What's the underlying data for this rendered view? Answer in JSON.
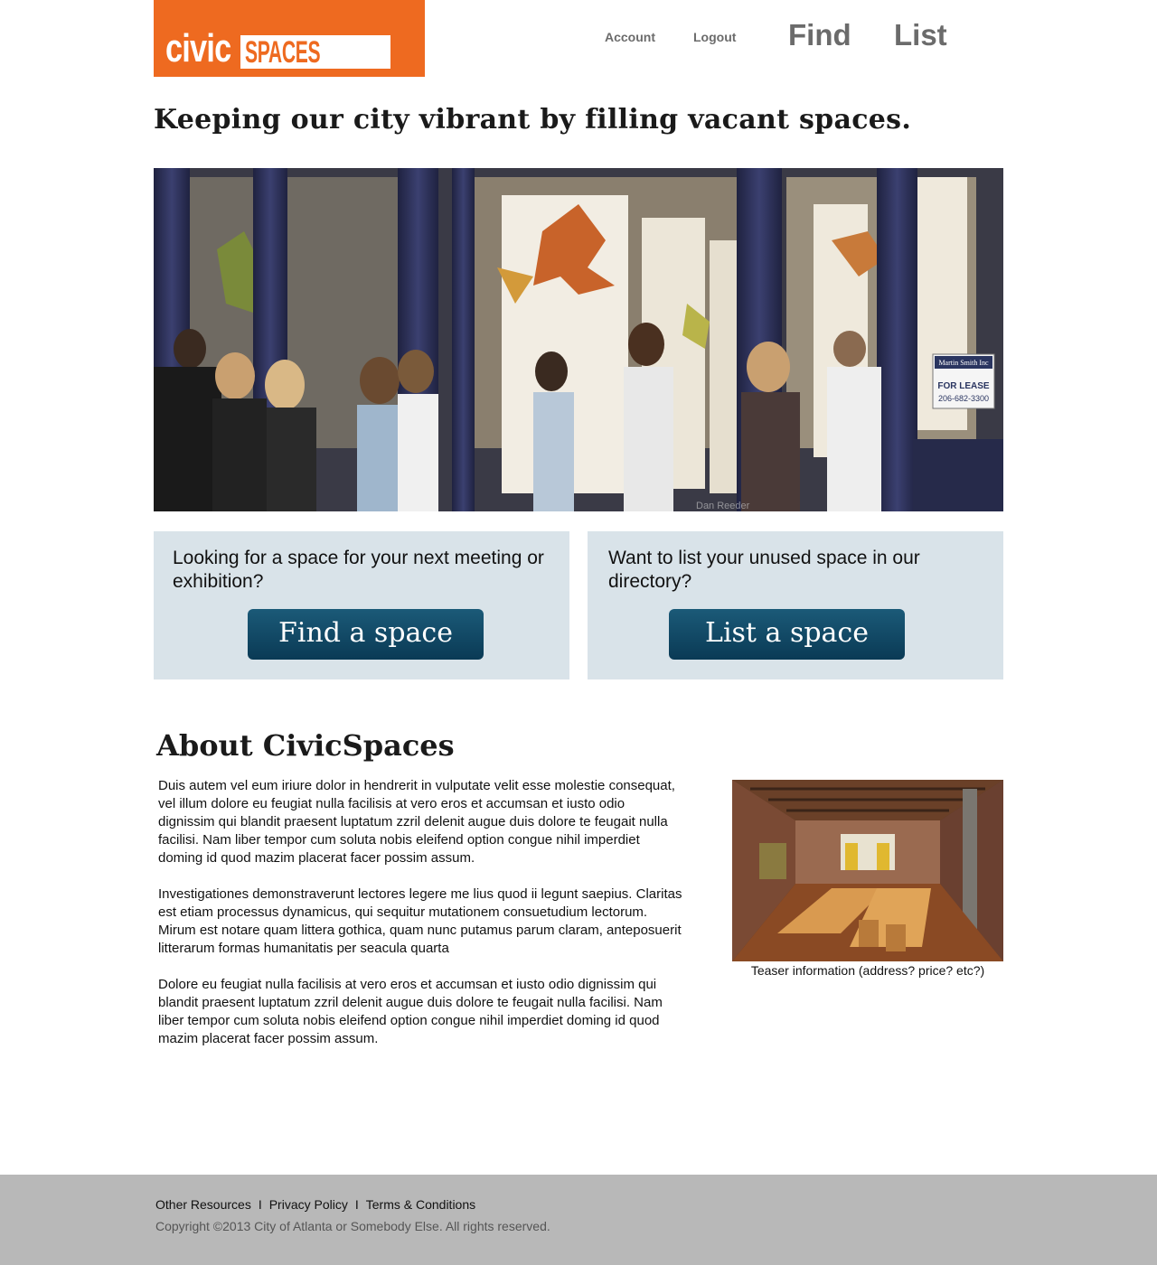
{
  "header": {
    "logo": {
      "word1": "civic",
      "word2": "SPACES"
    },
    "nav": {
      "account": "Account",
      "logout": "Logout",
      "find": "Find",
      "list": "List"
    }
  },
  "tagline": "Keeping our city vibrant by filling vacant spaces.",
  "hero": {
    "sign_line1": "Martin Smith Inc",
    "sign_line2": "FOR LEASE",
    "sign_line3": "206-682-3300",
    "photo_credit": "Dan Reeder"
  },
  "cta": {
    "find": {
      "text": "Looking for a space for your next meeting or exhibition?",
      "button": "Find a space"
    },
    "list": {
      "text": "Want to list your unused space in our directory?",
      "button": "List a space"
    }
  },
  "about": {
    "title": "About CivicSpaces",
    "paragraphs": [
      "Duis autem vel eum iriure dolor in hendrerit in vulputate velit esse molestie consequat, vel illum dolore eu feugiat nulla facilisis at vero eros et accumsan et iusto odio dignissim qui blandit praesent luptatum zzril delenit augue duis dolore te feugait nulla facilisi. Nam liber tempor cum soluta nobis eleifend option congue nihil imperdiet doming id quod mazim placerat facer possim assum.",
      "Investigationes demonstraverunt lectores legere me lius quod ii legunt saepius. Claritas est etiam processus dynamicus, qui sequitur mutationem consuetudium lectorum. Mirum est notare quam littera gothica, quam nunc putamus parum claram, anteposuerit litterarum formas humanitatis per seacula quarta",
      "Dolore eu feugiat nulla facilisis at vero eros et accumsan et iusto odio dignissim qui blandit praesent luptatum zzril delenit augue duis dolore te feugait nulla facilisi. Nam liber tempor cum soluta nobis eleifend option congue nihil imperdiet doming id quod mazim placerat facer possim assum."
    ],
    "teaser_caption": "Teaser information (address? price? etc?)"
  },
  "footer": {
    "links": [
      "Other Resources",
      "Privacy Policy",
      "Terms & Conditions"
    ],
    "separator": "I",
    "copyright": "Copyright ©2013 City of Atlanta or Somebody Else. All rights reserved."
  },
  "colors": {
    "brand_orange": "#ee6a20",
    "button_blue": "#0a3a55",
    "cta_bg": "#d9e3e9",
    "footer_bg": "#b8b8b8"
  }
}
